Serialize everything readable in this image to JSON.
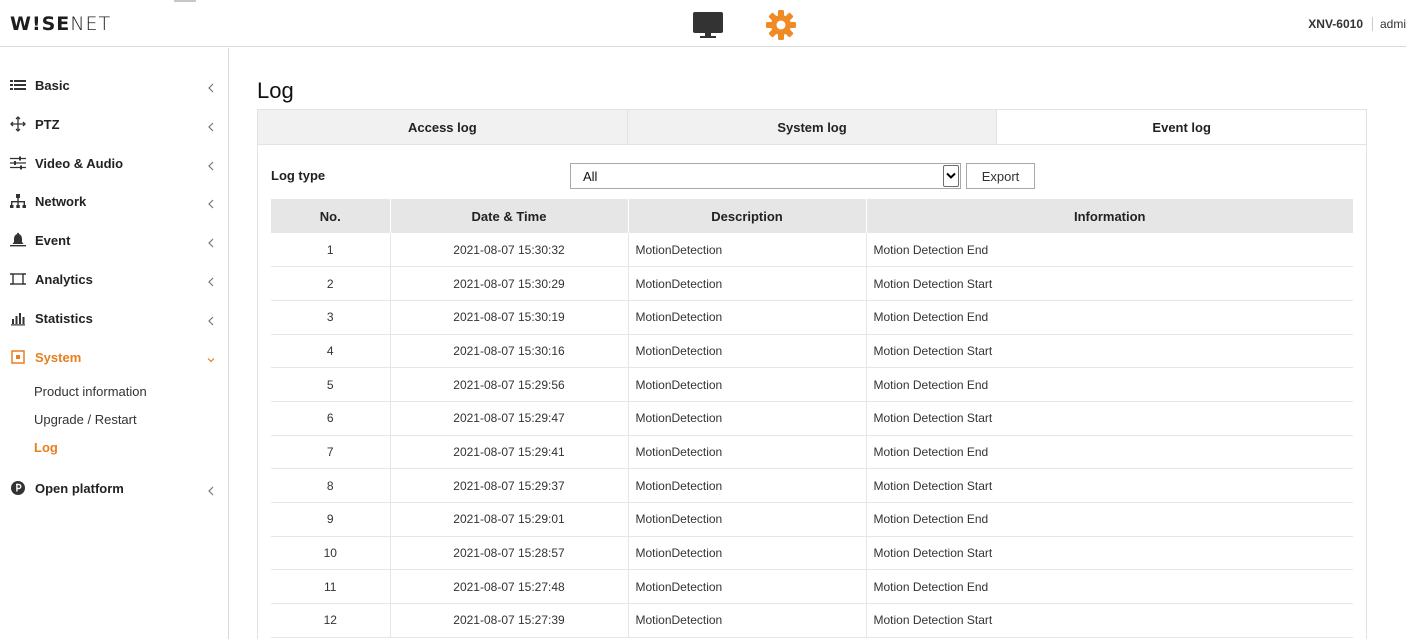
{
  "header": {
    "logo_bold": "W!SE",
    "logo_thin": "NET",
    "monitor_icon": "monitor-icon",
    "settings_icon": "gear-icon",
    "model": "XNV-6010",
    "user": "admin",
    "accent_color": "#f08a24"
  },
  "sidebar": {
    "items": [
      {
        "label": "Basic",
        "icon": "list-icon"
      },
      {
        "label": "PTZ",
        "icon": "move-arrows-icon"
      },
      {
        "label": "Video & Audio",
        "icon": "sliders-icon"
      },
      {
        "label": "Network",
        "icon": "network-icon"
      },
      {
        "label": "Event",
        "icon": "bell-icon"
      },
      {
        "label": "Analytics",
        "icon": "analytics-icon"
      },
      {
        "label": "Statistics",
        "icon": "bar-chart-icon"
      },
      {
        "label": "System",
        "icon": "system-icon"
      },
      {
        "label": "Open platform",
        "icon": "open-platform-icon"
      }
    ],
    "system_sub": [
      "Product information",
      "Upgrade / Restart",
      "Log"
    ]
  },
  "main": {
    "title": "Log",
    "tabs": [
      "Access log",
      "System log",
      "Event log"
    ],
    "log_type_label": "Log type",
    "log_type_value": "All",
    "export_label": "Export",
    "table": {
      "headers": [
        "No.",
        "Date & Time",
        "Description",
        "Information"
      ],
      "rows": [
        [
          "1",
          "2021-08-07 15:30:32",
          "MotionDetection",
          "Motion Detection End"
        ],
        [
          "2",
          "2021-08-07 15:30:29",
          "MotionDetection",
          "Motion Detection Start"
        ],
        [
          "3",
          "2021-08-07 15:30:19",
          "MotionDetection",
          "Motion Detection End"
        ],
        [
          "4",
          "2021-08-07 15:30:16",
          "MotionDetection",
          "Motion Detection Start"
        ],
        [
          "5",
          "2021-08-07 15:29:56",
          "MotionDetection",
          "Motion Detection End"
        ],
        [
          "6",
          "2021-08-07 15:29:47",
          "MotionDetection",
          "Motion Detection Start"
        ],
        [
          "7",
          "2021-08-07 15:29:41",
          "MotionDetection",
          "Motion Detection End"
        ],
        [
          "8",
          "2021-08-07 15:29:37",
          "MotionDetection",
          "Motion Detection Start"
        ],
        [
          "9",
          "2021-08-07 15:29:01",
          "MotionDetection",
          "Motion Detection End"
        ],
        [
          "10",
          "2021-08-07 15:28:57",
          "MotionDetection",
          "Motion Detection Start"
        ],
        [
          "11",
          "2021-08-07 15:27:48",
          "MotionDetection",
          "Motion Detection End"
        ],
        [
          "12",
          "2021-08-07 15:27:39",
          "MotionDetection",
          "Motion Detection Start"
        ]
      ]
    }
  }
}
